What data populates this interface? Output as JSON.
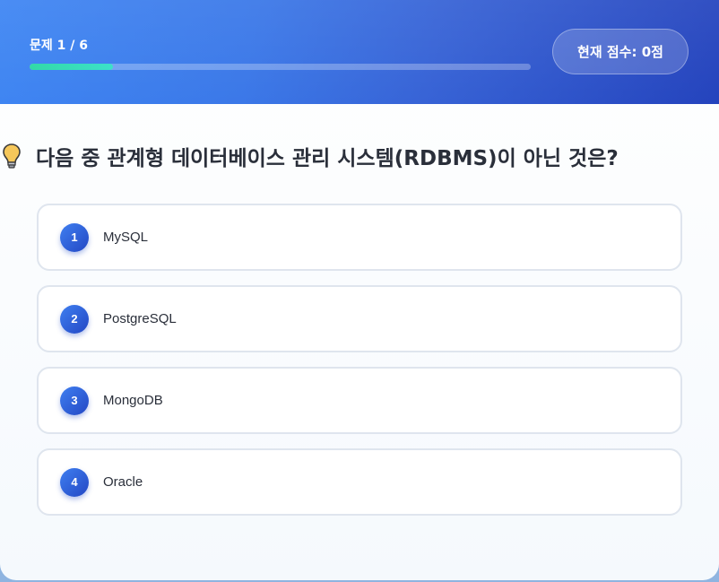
{
  "header": {
    "progress_label": "문제 1 / 6",
    "progress_value": 0.1667,
    "score_label": "현재 점수: 0점"
  },
  "question": {
    "icon": "lightbulb-icon",
    "text": "다음 중 관계형 데이터베이스 관리 시스템(RDBMS)이 아닌 것은?"
  },
  "options": [
    {
      "number": "1",
      "label": "MySQL"
    },
    {
      "number": "2",
      "label": "PostgreSQL"
    },
    {
      "number": "3",
      "label": "MongoDB"
    },
    {
      "number": "4",
      "label": "Oracle"
    }
  ],
  "colors": {
    "header_start": "#3f86f3",
    "header_end": "#2443bd",
    "progress_fill": "#2ed8a6",
    "badge_accent": "#2f5fd6"
  }
}
